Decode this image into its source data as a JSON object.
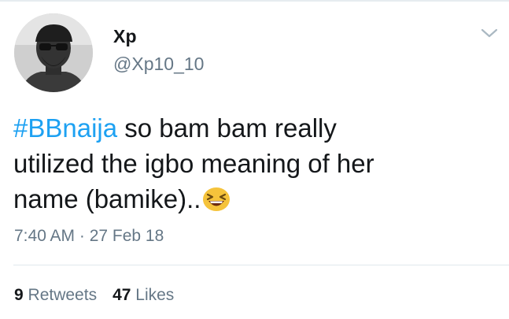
{
  "tweet": {
    "author": {
      "display_name": "Xp",
      "handle": "@Xp10_10",
      "avatar_icon": "user-avatar-photo"
    },
    "menu_icon": "chevron-down-icon",
    "text": {
      "hashtag": "#BBnaija",
      "line1_rest": " so bam bam really",
      "line2": "utilized the igbo meaning of her",
      "line3": "name (bamike)..",
      "emoji_icon": "grinning-squinting-face-emoji"
    },
    "timestamp": "7:40 AM · 27 Feb 18",
    "stats": {
      "retweets_count": "9",
      "retweets_label": "Retweets",
      "likes_count": "47",
      "likes_label": "Likes"
    }
  },
  "colors": {
    "link": "#1da1f2",
    "text": "#14171a",
    "secondary": "#657786",
    "divider": "#e1e8ed"
  }
}
